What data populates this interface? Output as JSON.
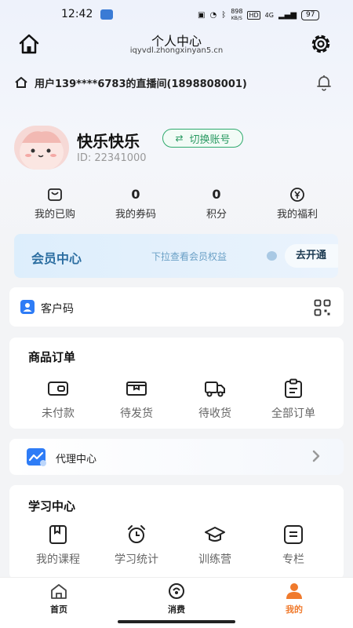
{
  "status_bar": {
    "time": "12:42",
    "network_speed": "898\nKB/S",
    "network_speed_value": "898",
    "network_speed_unit": "KB/S",
    "hd_badge": "HD",
    "signal": "4G",
    "battery": "97"
  },
  "header": {
    "title": "个人中心",
    "subtitle": "iqyvdl.zhongxinyan5.cn",
    "home_icon": "home-icon",
    "settings_icon": "gear-icon"
  },
  "live_room": {
    "text": "用户139****6783的直播间(1898808001)",
    "bell_icon": "bell-icon"
  },
  "profile": {
    "name": "快乐快乐",
    "switch_label": "切换账号",
    "id_text": "ID: 22341000"
  },
  "stats": [
    {
      "value": "",
      "label": "我的已购",
      "icon": "purchase-icon"
    },
    {
      "value": "0",
      "label": "我的券码",
      "icon": ""
    },
    {
      "value": "0",
      "label": "积分",
      "icon": ""
    },
    {
      "value": "",
      "label": "我的福利",
      "icon": "yen-coin-icon"
    }
  ],
  "vip": {
    "title": "会员中心",
    "hint": "下拉查看会员权益",
    "button": "去开通"
  },
  "customer_code": {
    "label": "客户码"
  },
  "orders": {
    "title": "商品订单",
    "items": [
      {
        "label": "未付款",
        "icon": "wallet-icon"
      },
      {
        "label": "待发货",
        "icon": "package-icon"
      },
      {
        "label": "待收货",
        "icon": "truck-icon"
      },
      {
        "label": "全部订单",
        "icon": "clipboard-icon"
      }
    ]
  },
  "agent": {
    "label": "代理中心"
  },
  "study": {
    "title": "学习中心",
    "items": [
      {
        "label": "我的课程",
        "icon": "book-icon"
      },
      {
        "label": "学习统计",
        "icon": "alarm-clock-icon"
      },
      {
        "label": "训练营",
        "icon": "graduation-cap-icon"
      },
      {
        "label": "专栏",
        "icon": "column-icon"
      }
    ]
  },
  "tabs": [
    {
      "label": "首页",
      "icon": "home-outline-icon",
      "active": false
    },
    {
      "label": "消费",
      "icon": "consume-icon",
      "active": false
    },
    {
      "label": "我的",
      "icon": "person-icon",
      "active": true
    }
  ],
  "colors": {
    "accent_orange": "#f07a2c",
    "switch_green": "#2faa6d",
    "vip_blue": "#2c6ea1"
  }
}
